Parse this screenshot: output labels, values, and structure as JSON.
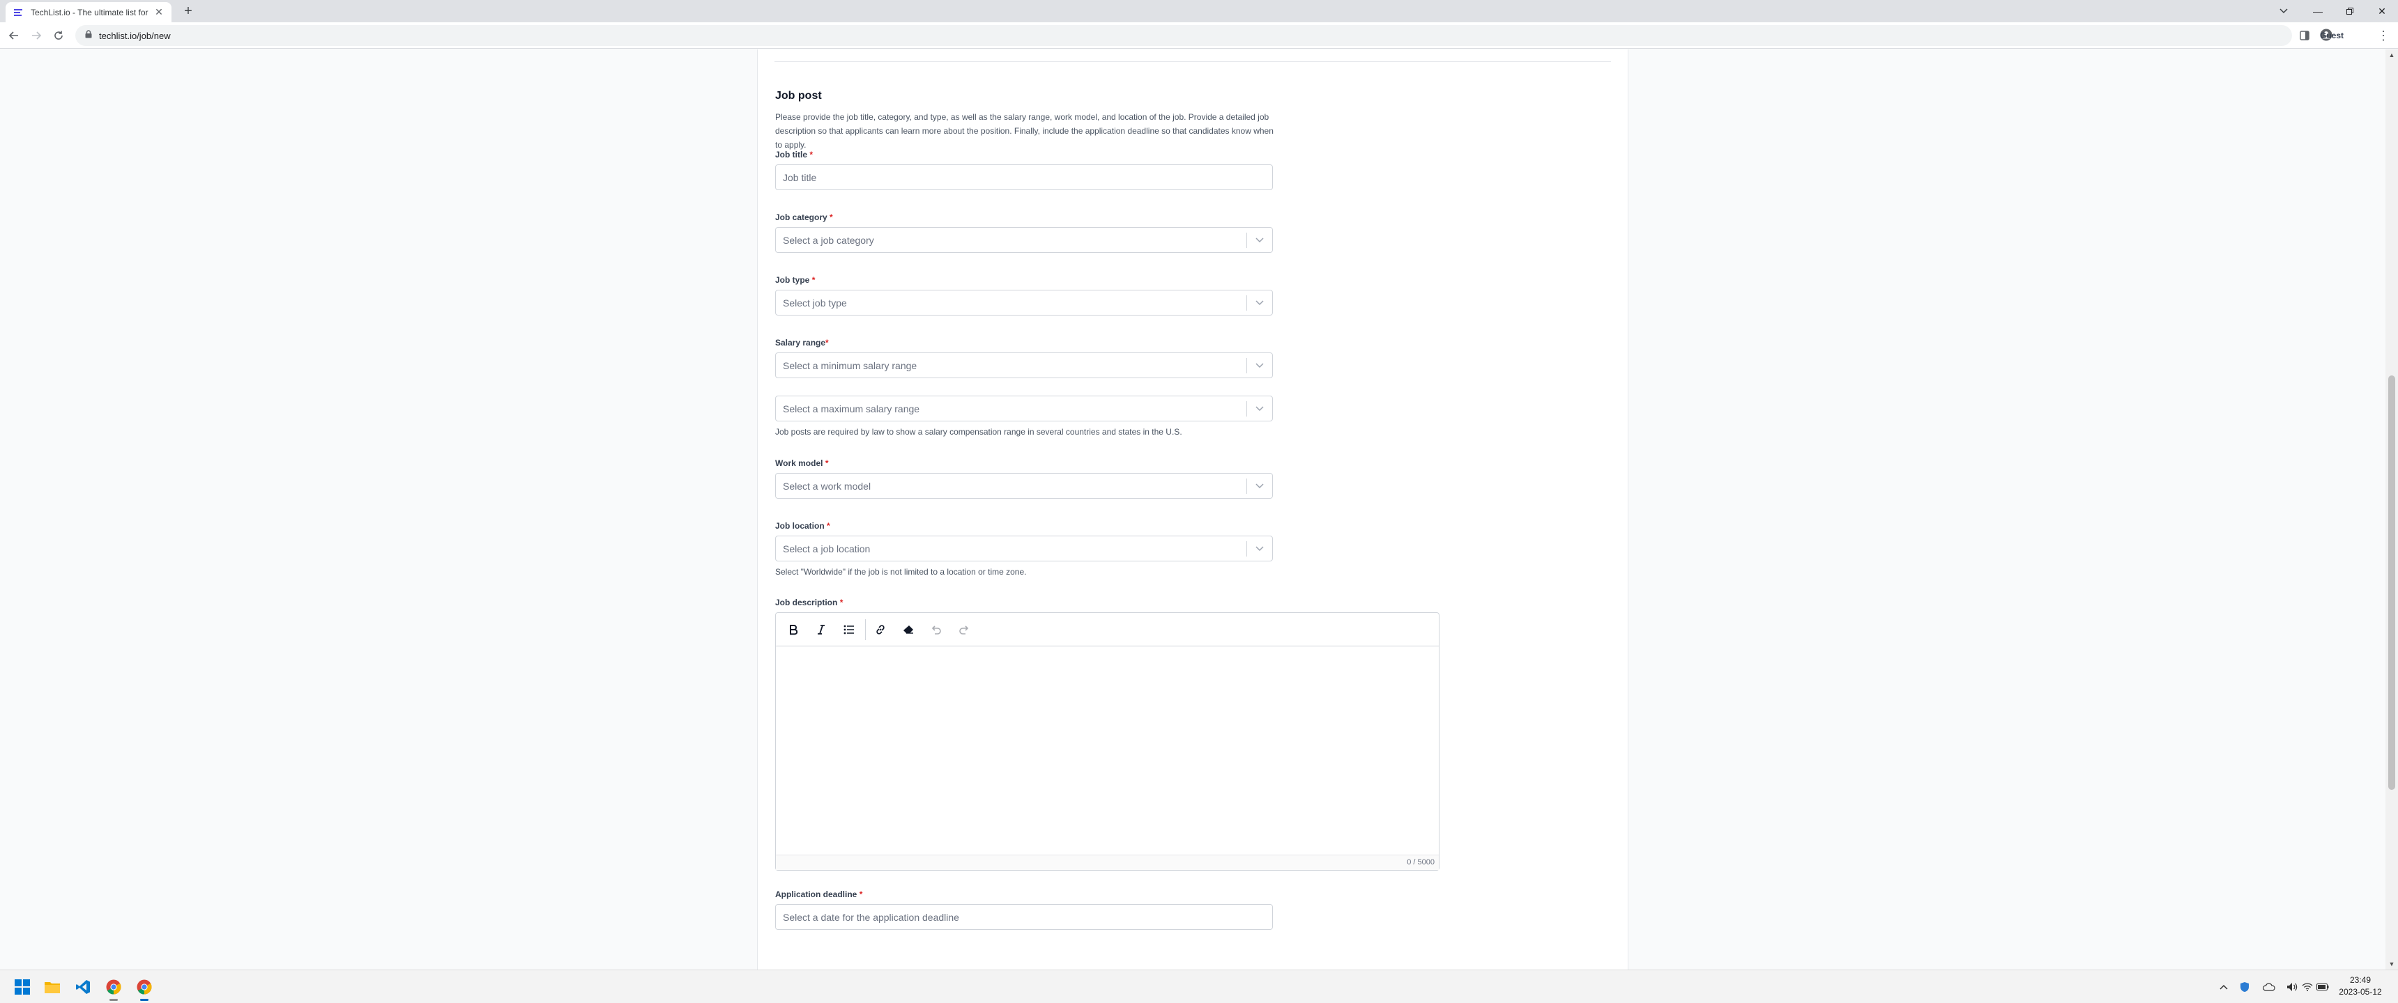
{
  "browser": {
    "tab_title": "TechList.io - The ultimate list for",
    "url": "techlist.io/job/new",
    "profile_label": "Guest"
  },
  "form": {
    "section_title": "Job post",
    "section_desc": "Please provide the job title, category, and type, as well as the salary range, work model, and location of the job. Provide a detailed job description so that applicants can learn more about the position. Finally, include the application deadline so that candidates know when to apply.",
    "job_title": {
      "label": "Job title",
      "required": "*",
      "placeholder": "Job title"
    },
    "job_category": {
      "label": "Job category",
      "required": "*",
      "placeholder": "Select a job category"
    },
    "job_type": {
      "label": "Job type",
      "required": "*",
      "placeholder": "Select job type"
    },
    "salary": {
      "label": "Salary range",
      "required": "*",
      "min_placeholder": "Select a minimum salary range",
      "max_placeholder": "Select a maximum salary range",
      "hint": "Job posts are required by law to show a salary compensation range in several countries and states in the U.S."
    },
    "work_model": {
      "label": "Work model",
      "required": "*",
      "placeholder": "Select a work model"
    },
    "job_location": {
      "label": "Job location",
      "required": "*",
      "placeholder": "Select a job location",
      "hint": "Select \"Worldwide\" if the job is not limited to a location or time zone."
    },
    "job_description": {
      "label": "Job description",
      "required": "*",
      "counter": "0 / 5000",
      "tools": [
        "bold-icon",
        "italic-icon",
        "bullet-list-icon",
        "link-icon",
        "eraser-icon",
        "undo-icon",
        "redo-icon"
      ]
    },
    "deadline": {
      "label": "Application deadline",
      "required": "*",
      "placeholder": "Select a date for the application deadline"
    }
  },
  "taskbar": {
    "apps": [
      "windows-start-icon",
      "file-explorer-icon",
      "vscode-icon",
      "chrome-icon",
      "chrome-icon"
    ],
    "time": "23:49",
    "date": "2023-05-12"
  },
  "colors": {
    "required": "#dc2626",
    "border": "#d1d5db",
    "placeholder": "#6b7280"
  }
}
